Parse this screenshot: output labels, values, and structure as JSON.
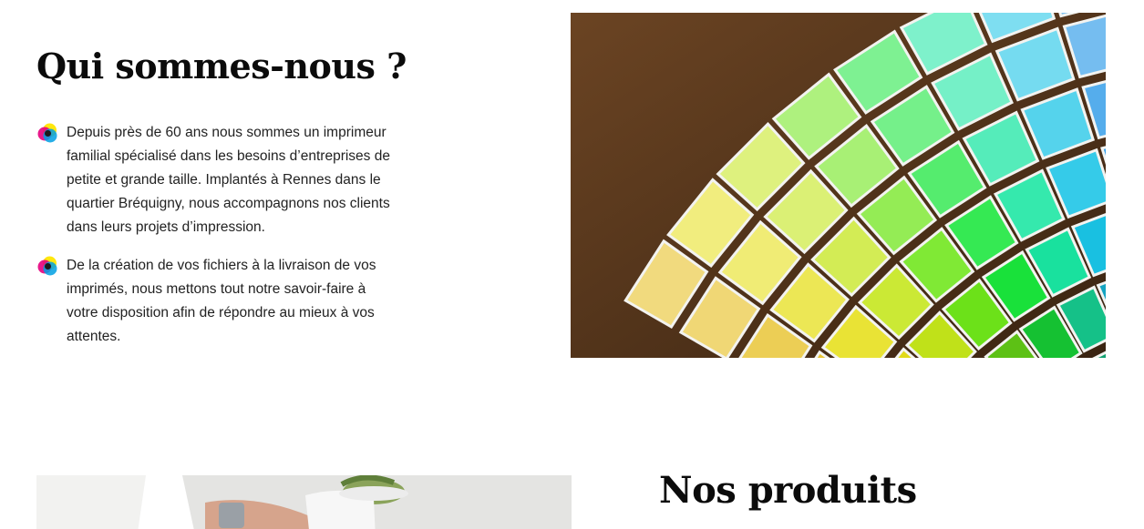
{
  "about": {
    "title": "Qui sommes-nous ?",
    "items": [
      {
        "icon": "cmyk-bullet-icon",
        "text": "Depuis près de 60 ans nous sommes un imprimeur familial spécialisé dans les besoins d’entreprises de petite et grande taille. Implantés à Rennes dans le quartier Bréquigny, nous accompagnons nos clients dans leurs projets d’impression."
      },
      {
        "icon": "cmyk-bullet-icon",
        "text": "De la création de vos fichiers à la livraison de vos imprimés, nous mettons tout notre savoir-faire à votre disposition afin de répondre au mieux à vos attentes."
      }
    ],
    "image": {
      "subject": "pantone-color-swatch-fan"
    }
  },
  "products": {
    "title": "Nos produits",
    "image": {
      "subject": "hands-with-plant-pot"
    }
  },
  "colors": {
    "cyan": "#00a0e3",
    "magenta": "#e6007e",
    "yellow": "#ffe600",
    "black": "#1a1a1a"
  }
}
